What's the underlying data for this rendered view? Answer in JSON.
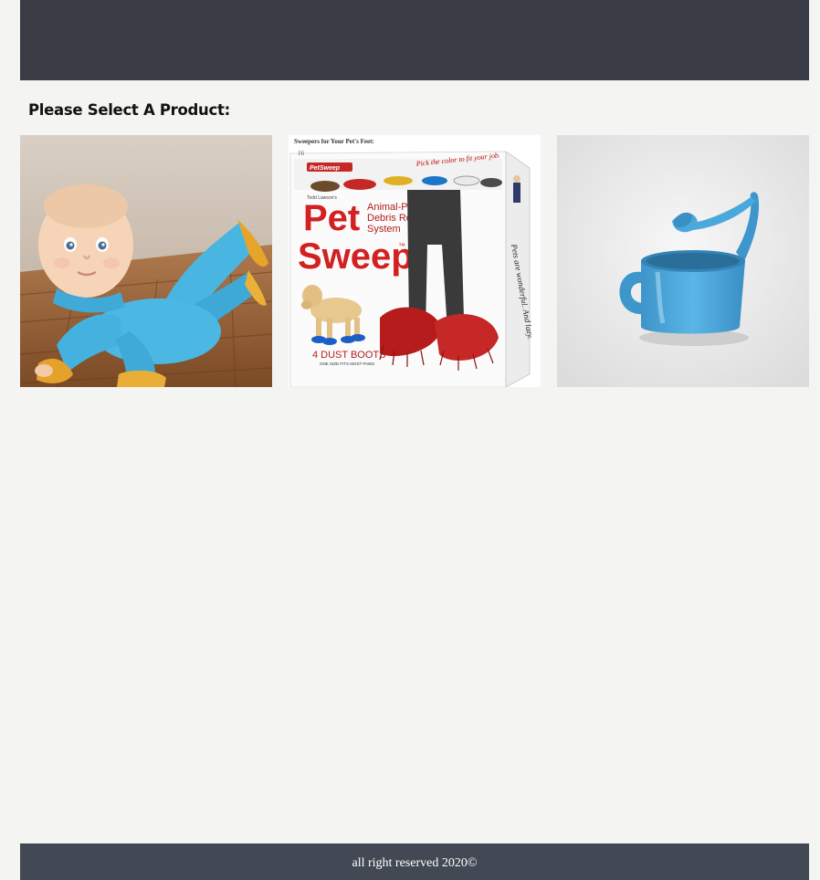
{
  "heading": "Please Select A Product:",
  "products": [
    {
      "image_name": "baby-mop-onesie-image"
    },
    {
      "image_name": "pet-sweep-box-image",
      "box_text": {
        "top_line": "Sweepers for Your Pet's Feet:",
        "number": "16",
        "brand_small": "PetSweep",
        "tagline": "Pick the color to fit your job.",
        "author": "Todd Lawson's",
        "title_line1": "Pet",
        "title_line2": "Sweep",
        "tm": "™",
        "sub1": "Animal-Powered",
        "sub2": "Debris Removal",
        "sub3": "System",
        "count": "4 DUST BOOTS",
        "count_sub": "ONE SIZE FITS MOST PAWS",
        "side": "Pets are wonderful. And lazy."
      }
    },
    {
      "image_name": "watering-can-mug-image"
    }
  ],
  "footer": {
    "text": "all right reserved 2020©"
  },
  "colors": {
    "header_bar": "#393c44",
    "footer_bar": "#424854",
    "page_background": "#f4f4f2",
    "product_blue": "#4aa8dc"
  }
}
